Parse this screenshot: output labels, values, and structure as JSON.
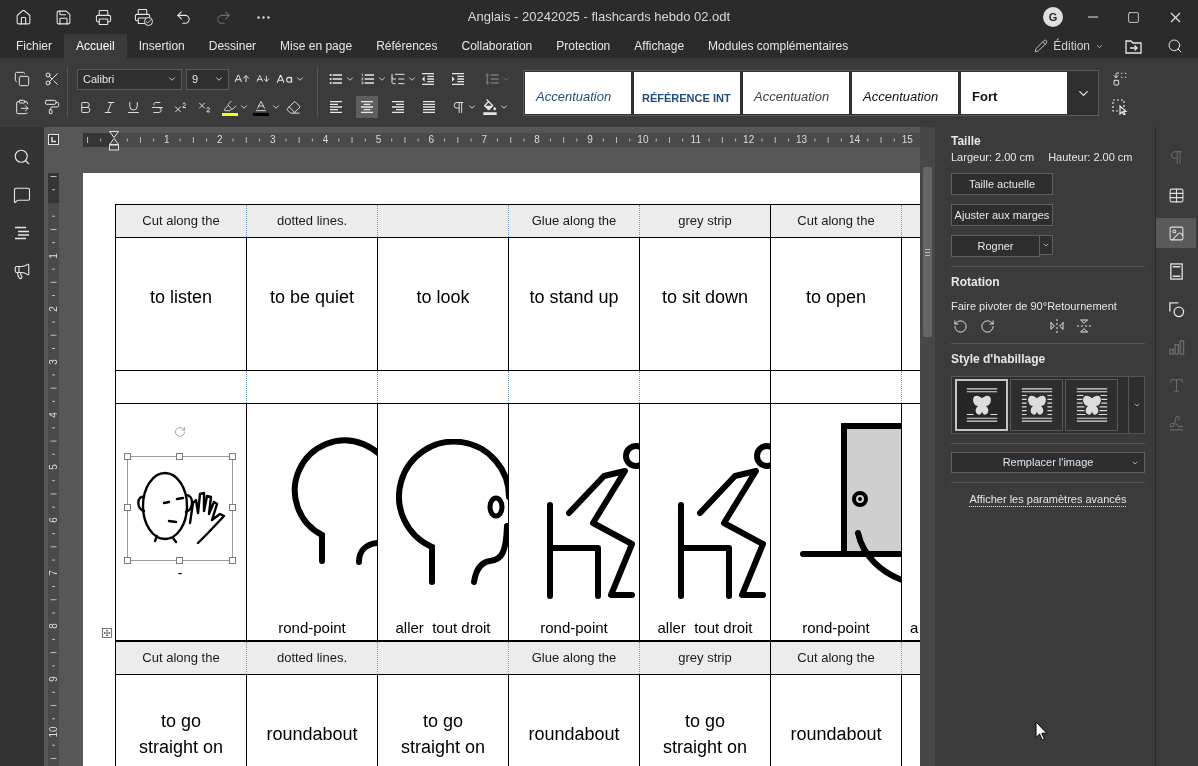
{
  "title_bar": {
    "quick_access": [
      {
        "kind": "home",
        "disabled": false
      },
      {
        "kind": "save",
        "disabled": false
      },
      {
        "kind": "print",
        "disabled": false
      },
      {
        "kind": "quick-print",
        "disabled": false
      },
      {
        "kind": "undo",
        "disabled": false
      },
      {
        "kind": "redo",
        "disabled": true
      },
      {
        "kind": "more",
        "disabled": false
      }
    ],
    "title": "Anglais - 20242025 - flashcards hebdo 02.odt",
    "account_initial": "G"
  },
  "menu_bar": {
    "tabs": [
      {
        "label": "Fichier",
        "selected": false
      },
      {
        "label": "Accueil",
        "selected": true
      },
      {
        "label": "Insertion",
        "selected": false
      },
      {
        "label": "Dessiner",
        "selected": false
      },
      {
        "label": "Mise en page",
        "selected": false
      },
      {
        "label": "Références",
        "selected": false
      },
      {
        "label": "Collaboration",
        "selected": false
      },
      {
        "label": "Protection",
        "selected": false
      },
      {
        "label": "Affichage",
        "selected": false
      },
      {
        "label": "Modules complémentaires",
        "selected": false
      }
    ],
    "mode": "Édition"
  },
  "toolbar": {
    "font_name": "Calibri",
    "font_size": "9",
    "alignment": [
      {
        "kind": "left",
        "selected": false
      },
      {
        "kind": "center",
        "selected": true
      },
      {
        "kind": "right",
        "selected": false
      },
      {
        "kind": "justify",
        "selected": false
      }
    ],
    "line_spacing": {
      "disabled": true
    },
    "styles": [
      {
        "label": "Accentuation",
        "kind": "subtle-emphasis"
      },
      {
        "label": "RÉFÉRENCE INT",
        "kind": "intense-reference"
      },
      {
        "label": "Accentuation",
        "kind": "subtle"
      },
      {
        "label": "Accentuation",
        "kind": "emphasis"
      },
      {
        "label": "Fort",
        "kind": "strong"
      }
    ]
  },
  "ruler": {
    "horizontal": [
      "1",
      "2",
      "3",
      "4",
      "5",
      "6",
      "7",
      "8",
      "9",
      "10",
      "11",
      "12",
      "13",
      "14",
      "15"
    ],
    "vertical": [
      "1",
      "2",
      "3",
      "4",
      "5",
      "6",
      "7",
      "8",
      "9",
      "10"
    ]
  },
  "table": {
    "rows": [
      {
        "kind": "strip",
        "cells": [
          {
            "text": "Cut along the"
          },
          {
            "text": "dotted lines."
          },
          {},
          {
            "text": "Glue along the"
          },
          {
            "text": "grey strip"
          },
          {
            "text": "Cut along the"
          },
          {}
        ]
      },
      {
        "kind": "word",
        "cells": [
          {
            "text": "to listen"
          },
          {
            "text": "to be quiet"
          },
          {
            "text": "to look"
          },
          {
            "text": "to stand up"
          },
          {
            "text": "to sit down"
          },
          {
            "text": "to open"
          },
          {}
        ]
      },
      {
        "kind": "spacer",
        "cells": [
          {},
          {},
          {},
          {},
          {},
          {},
          {}
        ]
      },
      {
        "kind": "picture",
        "cells": [
          {
            "kind": "face-hand",
            "selected": true,
            "caption": "-"
          },
          {
            "kind": "head",
            "selected": false,
            "caption": "rond-point"
          },
          {
            "kind": "head-ear",
            "selected": false,
            "caption": "aller  tout droit"
          },
          {
            "kind": "sitting",
            "selected": false,
            "caption": "rond-point"
          },
          {
            "kind": "sitting",
            "selected": false,
            "caption": "aller  tout droit"
          },
          {
            "kind": "door",
            "selected": false,
            "caption": "rond-point"
          },
          {
            "caption": "a"
          }
        ]
      },
      {
        "kind": "strip",
        "cells": [
          {
            "text": "Cut along the"
          },
          {
            "text": "dotted lines."
          },
          {},
          {
            "text": "Glue along the"
          },
          {
            "text": "grey strip"
          },
          {
            "text": "Cut along the"
          },
          {}
        ]
      },
      {
        "kind": "word",
        "cells": [
          {
            "text": "to go straight on"
          },
          {
            "text": "roundabout"
          },
          {
            "text": "to go straight on"
          },
          {
            "text": "roundabout"
          },
          {
            "text": "to go straight on"
          },
          {
            "text": "roundabout"
          },
          {}
        ]
      }
    ]
  },
  "image_settings": {
    "size_heading": "Taille",
    "width": "Largeur: 2.00 cm",
    "height": "Hauteur: 2.00 cm",
    "actual_size": "Taille actuelle",
    "fit_margins": "Ajuster aux marges",
    "crop": "Rogner",
    "rotation_heading": "Rotation",
    "rotate_label": "Faire pivoter de 90°",
    "flip_label": "Retournement",
    "wrap_heading": "Style d'habillage",
    "wrap_styles": [
      {
        "kind": "inline",
        "selected": true
      },
      {
        "kind": "square",
        "selected": false
      },
      {
        "kind": "tight",
        "selected": false
      }
    ],
    "replace": "Remplacer l'image",
    "advanced_link": "Afficher les paramètres avancés"
  },
  "panel_tabs": [
    {
      "kind": "paragraph",
      "selected": false,
      "disabled": true
    },
    {
      "kind": "table",
      "selected": false,
      "disabled": false
    },
    {
      "kind": "image",
      "selected": true,
      "disabled": false
    },
    {
      "kind": "header-footer",
      "selected": false,
      "disabled": false
    },
    {
      "kind": "shape",
      "selected": false,
      "disabled": false
    },
    {
      "kind": "chart",
      "selected": false,
      "disabled": true
    },
    {
      "kind": "text-art",
      "selected": false,
      "disabled": true
    },
    {
      "kind": "signature",
      "selected": false,
      "disabled": true
    }
  ]
}
